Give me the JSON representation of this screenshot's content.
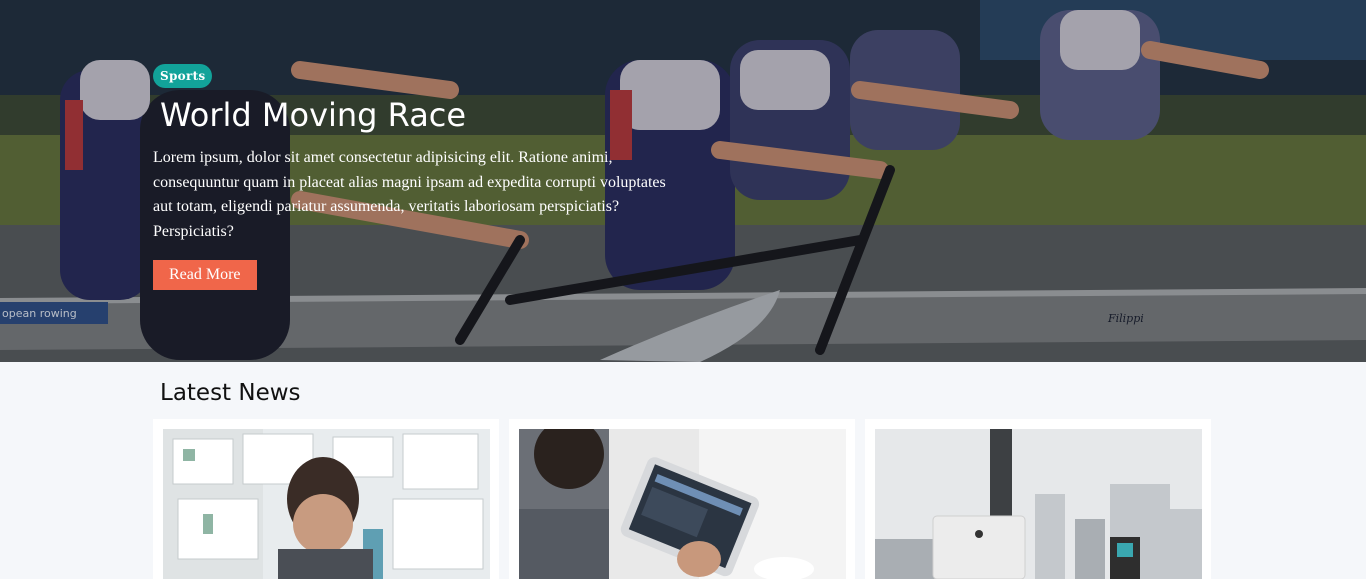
{
  "hero": {
    "badge": "Sports",
    "title": "World Moving Race",
    "text": "Lorem ipsum, dolor sit amet consectetur adipisicing elit. Ratione animi, consequuntur quam in placeat alias magni ipsam ad expedita corrupti voluptates aut totam, eligendi pariatur assumenda, veritatis laboriosam perspiciatis? Perspiciatis?",
    "button": "Read More",
    "boat_sponsor_text": "opean rowing",
    "boat_brand_text": "Filippi"
  },
  "news": {
    "heading": "Latest News",
    "cards": [
      {
        "image": "planning-board-photo"
      },
      {
        "image": "tablet-reading-photo"
      },
      {
        "image": "office-desk-photo"
      }
    ]
  },
  "colors": {
    "badge": "#12a39a",
    "button": "#f0664a",
    "page_bg": "#f5f7fa"
  }
}
